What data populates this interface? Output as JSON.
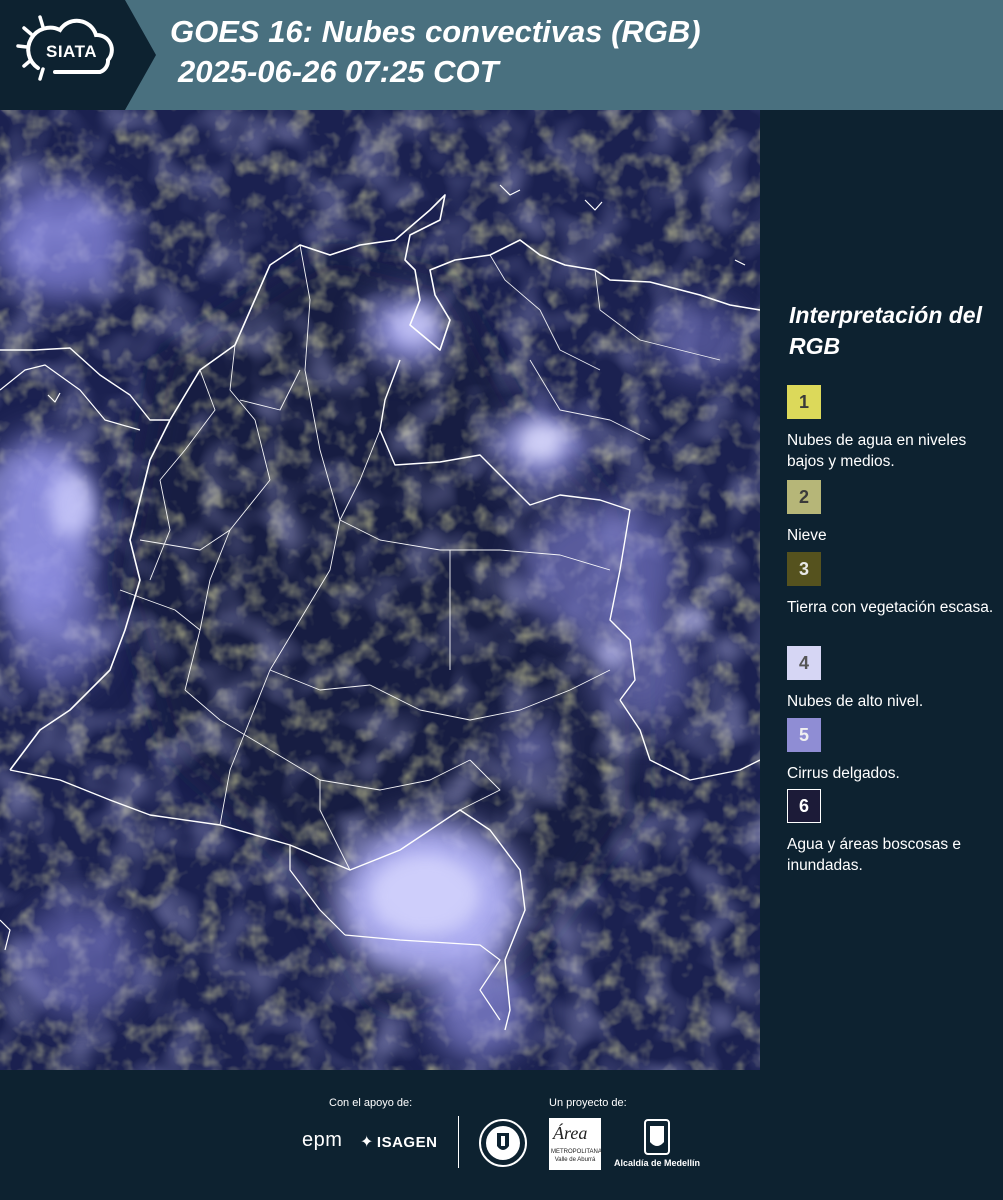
{
  "header": {
    "logo_text": "SIATA",
    "title_line1": "GOES 16: Nubes convectivas (RGB)",
    "title_line2": "2025-06-26 07:25 COT",
    "background": "#49707f"
  },
  "map": {
    "description_icon": "satellite-rgb-map",
    "boundary_color": "#ffffff"
  },
  "legend": {
    "title": "Interpretación del RGB",
    "items": [
      {
        "number": "1",
        "label": "Nubes de agua en niveles bajos y medios.",
        "color": "#dcd95a"
      },
      {
        "number": "2",
        "label": "Nieve",
        "color": "#b6b678"
      },
      {
        "number": "3",
        "label": "Tierra con vegetación escasa.",
        "color": "#55521e"
      },
      {
        "number": "4",
        "label": "Nubes de alto nivel.",
        "color": "#d6d6f4"
      },
      {
        "number": "5",
        "label": "Cirrus delgados.",
        "color": "#8f8dd4"
      },
      {
        "number": "6",
        "label": "Agua y áreas boscosas e inundadas.",
        "color": "#1c1b38"
      }
    ]
  },
  "footer": {
    "support_label": "Con el apoyo de:",
    "project_label": "Un proyecto de:",
    "sponsors": [
      "epm",
      "ISAGEN"
    ],
    "partners": [
      "Área Metropolitana Valle de Aburrá",
      "Alcaldía de Medellín"
    ],
    "area_logo_text": "Área",
    "area_logo_sub": "METROPOLITANA Valle de Aburrá",
    "alcaldia_text": "Alcaldía de Medellín"
  }
}
